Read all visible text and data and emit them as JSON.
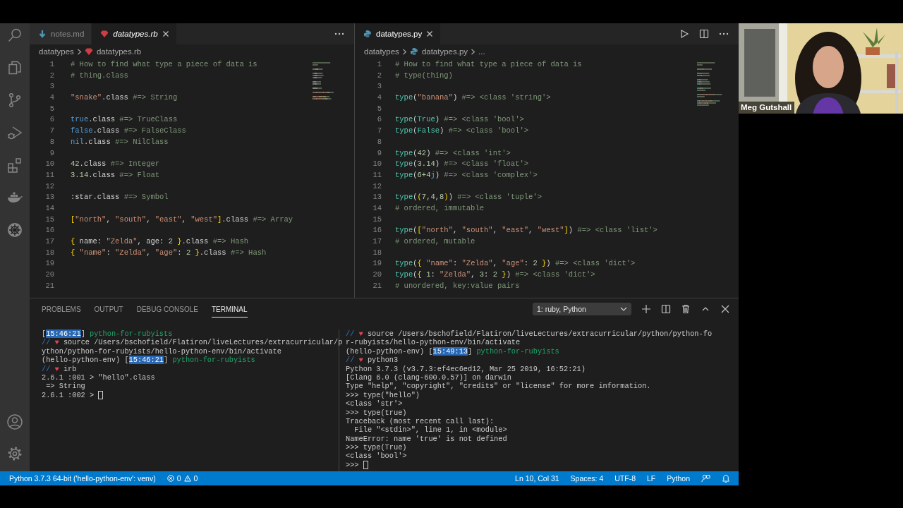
{
  "left_editor": {
    "tabs": [
      {
        "label": "notes.md",
        "kind": "markdown",
        "selected": false,
        "preview": false
      },
      {
        "label": "datatypes.rb",
        "kind": "ruby",
        "selected": true,
        "preview": true
      }
    ],
    "breadcrumb": [
      {
        "label": "datatypes"
      },
      {
        "label": "datatypes.rb",
        "kind": "ruby"
      }
    ],
    "lines": [
      {
        "number": "1",
        "tokens": [
          {
            "text": "# How to find what type a piece of data is",
            "kind": "comment"
          }
        ]
      },
      {
        "number": "2",
        "tokens": [
          {
            "text": "# thing.class",
            "kind": "comment"
          }
        ]
      },
      {
        "number": "3"
      },
      {
        "number": "4",
        "tokens": [
          {
            "text": "\"snake\"",
            "kind": "string"
          },
          {
            "text": ".class ",
            "kind": "plain"
          },
          {
            "text": "#=> String",
            "kind": "comment"
          }
        ]
      },
      {
        "number": "5"
      },
      {
        "number": "6",
        "tokens": [
          {
            "text": "true",
            "kind": "keyword"
          },
          {
            "text": ".class ",
            "kind": "plain"
          },
          {
            "text": "#=> TrueClass",
            "kind": "comment"
          }
        ]
      },
      {
        "number": "7",
        "tokens": [
          {
            "text": "false",
            "kind": "keyword"
          },
          {
            "text": ".class ",
            "kind": "plain"
          },
          {
            "text": "#=> FalseClass",
            "kind": "comment"
          }
        ]
      },
      {
        "number": "8",
        "tokens": [
          {
            "text": "nil",
            "kind": "keyword"
          },
          {
            "text": ".class ",
            "kind": "plain"
          },
          {
            "text": "#=> NilClass",
            "kind": "comment"
          }
        ]
      },
      {
        "number": "9"
      },
      {
        "number": "10",
        "tokens": [
          {
            "text": "42",
            "kind": "number"
          },
          {
            "text": ".class ",
            "kind": "plain"
          },
          {
            "text": "#=> Integer",
            "kind": "comment"
          }
        ]
      },
      {
        "number": "11",
        "tokens": [
          {
            "text": "3.14",
            "kind": "number"
          },
          {
            "text": ".class ",
            "kind": "plain"
          },
          {
            "text": "#=> Float",
            "kind": "comment"
          }
        ]
      },
      {
        "number": "12"
      },
      {
        "number": "13",
        "tokens": [
          {
            "text": ":star",
            "kind": "plain"
          },
          {
            "text": ".class ",
            "kind": "plain"
          },
          {
            "text": "#=> Symbol",
            "kind": "comment"
          }
        ]
      },
      {
        "number": "14"
      },
      {
        "number": "15",
        "tokens": [
          {
            "text": "[",
            "kind": "bracket"
          },
          {
            "text": "\"north\"",
            "kind": "string"
          },
          {
            "text": ", ",
            "kind": "plain"
          },
          {
            "text": "\"south\"",
            "kind": "string"
          },
          {
            "text": ", ",
            "kind": "plain"
          },
          {
            "text": "\"east\"",
            "kind": "string"
          },
          {
            "text": ", ",
            "kind": "plain"
          },
          {
            "text": "\"west\"",
            "kind": "string"
          },
          {
            "text": "]",
            "kind": "bracket"
          },
          {
            "text": ".class ",
            "kind": "plain"
          },
          {
            "text": "#=> Array",
            "kind": "comment"
          }
        ]
      },
      {
        "number": "16"
      },
      {
        "number": "17",
        "tokens": [
          {
            "text": "{",
            "kind": "bracket"
          },
          {
            "text": " name: ",
            "kind": "plain"
          },
          {
            "text": "\"Zelda\"",
            "kind": "string"
          },
          {
            "text": ", age: ",
            "kind": "plain"
          },
          {
            "text": "2",
            "kind": "number"
          },
          {
            "text": " }",
            "kind": "bracket"
          },
          {
            "text": ".class ",
            "kind": "plain"
          },
          {
            "text": "#=> Hash",
            "kind": "comment"
          }
        ]
      },
      {
        "number": "18",
        "tokens": [
          {
            "text": "{ ",
            "kind": "bracket"
          },
          {
            "text": "\"name\"",
            "kind": "string"
          },
          {
            "text": ": ",
            "kind": "plain"
          },
          {
            "text": "\"Zelda\"",
            "kind": "string"
          },
          {
            "text": ", ",
            "kind": "plain"
          },
          {
            "text": "\"age\"",
            "kind": "string"
          },
          {
            "text": ": ",
            "kind": "plain"
          },
          {
            "text": "2",
            "kind": "number"
          },
          {
            "text": " }",
            "kind": "bracket"
          },
          {
            "text": ".class ",
            "kind": "plain"
          },
          {
            "text": "#=> Hash",
            "kind": "comment"
          }
        ]
      },
      {
        "number": "19"
      },
      {
        "number": "20"
      },
      {
        "number": "21"
      }
    ]
  },
  "right_editor": {
    "tabs": [
      {
        "label": "datatypes.py",
        "kind": "python",
        "selected": true,
        "preview": false
      }
    ],
    "breadcrumb": [
      {
        "label": "datatypes"
      },
      {
        "label": "datatypes.py",
        "kind": "python"
      },
      {
        "label": "..."
      }
    ],
    "lines": [
      {
        "number": "1",
        "tokens": [
          {
            "text": "# How to find what type a piece of data is",
            "kind": "comment"
          }
        ]
      },
      {
        "number": "2",
        "tokens": [
          {
            "text": "# type(thing)",
            "kind": "comment"
          }
        ]
      },
      {
        "number": "3"
      },
      {
        "number": "4",
        "tokens": [
          {
            "text": "type",
            "kind": "function"
          },
          {
            "text": "(",
            "kind": "plain"
          },
          {
            "text": "\"banana\"",
            "kind": "string"
          },
          {
            "text": ") ",
            "kind": "plain"
          },
          {
            "text": "#=> <class 'string'>",
            "kind": "comment"
          }
        ]
      },
      {
        "number": "5"
      },
      {
        "number": "6",
        "tokens": [
          {
            "text": "type",
            "kind": "function"
          },
          {
            "text": "(",
            "kind": "plain"
          },
          {
            "text": "True",
            "kind": "constant"
          },
          {
            "text": ") ",
            "kind": "plain"
          },
          {
            "text": "#=> <class 'bool'>",
            "kind": "comment"
          }
        ]
      },
      {
        "number": "7",
        "tokens": [
          {
            "text": "type",
            "kind": "function"
          },
          {
            "text": "(",
            "kind": "plain"
          },
          {
            "text": "False",
            "kind": "constant"
          },
          {
            "text": ") ",
            "kind": "plain"
          },
          {
            "text": "#=> <class 'bool'>",
            "kind": "comment"
          }
        ]
      },
      {
        "number": "8"
      },
      {
        "number": "9",
        "tokens": [
          {
            "text": "type",
            "kind": "function"
          },
          {
            "text": "(",
            "kind": "plain"
          },
          {
            "text": "42",
            "kind": "number"
          },
          {
            "text": ") ",
            "kind": "plain"
          },
          {
            "text": "#=> <class 'int'>",
            "kind": "comment"
          }
        ]
      },
      {
        "number": "10",
        "tokens": [
          {
            "text": "type",
            "kind": "function"
          },
          {
            "text": "(",
            "kind": "plain"
          },
          {
            "text": "3.14",
            "kind": "number"
          },
          {
            "text": ") ",
            "kind": "plain"
          },
          {
            "text": "#=> <class 'float'>",
            "kind": "comment"
          }
        ]
      },
      {
        "number": "11",
        "tokens": [
          {
            "text": "type",
            "kind": "function"
          },
          {
            "text": "(",
            "kind": "plain"
          },
          {
            "text": "6+4",
            "kind": "number"
          },
          {
            "text": "j",
            "kind": "keyword"
          },
          {
            "text": ") ",
            "kind": "plain"
          },
          {
            "text": "#=> <class 'complex'>",
            "kind": "comment"
          }
        ]
      },
      {
        "number": "12"
      },
      {
        "number": "13",
        "tokens": [
          {
            "text": "type",
            "kind": "function"
          },
          {
            "text": "(",
            "kind": "plain"
          },
          {
            "text": "(",
            "kind": "bracket"
          },
          {
            "text": "7,4,8",
            "kind": "number"
          },
          {
            "text": ")",
            "kind": "bracket"
          },
          {
            "text": ") ",
            "kind": "plain"
          },
          {
            "text": "#=> <class 'tuple'>",
            "kind": "comment"
          }
        ]
      },
      {
        "number": "14",
        "tokens": [
          {
            "text": "# ordered, immutable",
            "kind": "comment"
          }
        ]
      },
      {
        "number": "15"
      },
      {
        "number": "16",
        "tokens": [
          {
            "text": "type",
            "kind": "function"
          },
          {
            "text": "(",
            "kind": "plain"
          },
          {
            "text": "[",
            "kind": "bracket"
          },
          {
            "text": "\"north\"",
            "kind": "string"
          },
          {
            "text": ", ",
            "kind": "plain"
          },
          {
            "text": "\"south\"",
            "kind": "string"
          },
          {
            "text": ", ",
            "kind": "plain"
          },
          {
            "text": "\"east\"",
            "kind": "string"
          },
          {
            "text": ", ",
            "kind": "plain"
          },
          {
            "text": "\"west\"",
            "kind": "string"
          },
          {
            "text": "]",
            "kind": "bracket"
          },
          {
            "text": ") ",
            "kind": "plain"
          },
          {
            "text": "#=> <class 'list'>",
            "kind": "comment"
          }
        ]
      },
      {
        "number": "17",
        "tokens": [
          {
            "text": "# ordered, mutable",
            "kind": "comment"
          }
        ]
      },
      {
        "number": "18"
      },
      {
        "number": "19",
        "tokens": [
          {
            "text": "type",
            "kind": "function"
          },
          {
            "text": "(",
            "kind": "plain"
          },
          {
            "text": "{ ",
            "kind": "bracket"
          },
          {
            "text": "\"name\"",
            "kind": "string"
          },
          {
            "text": ": ",
            "kind": "plain"
          },
          {
            "text": "\"Zelda\"",
            "kind": "string"
          },
          {
            "text": ", ",
            "kind": "plain"
          },
          {
            "text": "\"age\"",
            "kind": "string"
          },
          {
            "text": ": ",
            "kind": "plain"
          },
          {
            "text": "2",
            "kind": "number"
          },
          {
            "text": " }",
            "kind": "bracket"
          },
          {
            "text": ") ",
            "kind": "plain"
          },
          {
            "text": "#=> <class 'dict'>",
            "kind": "comment"
          }
        ]
      },
      {
        "number": "20",
        "tokens": [
          {
            "text": "type",
            "kind": "function"
          },
          {
            "text": "(",
            "kind": "plain"
          },
          {
            "text": "{ ",
            "kind": "bracket"
          },
          {
            "text": "1",
            "kind": "number"
          },
          {
            "text": ": ",
            "kind": "plain"
          },
          {
            "text": "\"Zelda\"",
            "kind": "string"
          },
          {
            "text": ", ",
            "kind": "plain"
          },
          {
            "text": "3",
            "kind": "number"
          },
          {
            "text": ": ",
            "kind": "plain"
          },
          {
            "text": "2",
            "kind": "number"
          },
          {
            "text": " }",
            "kind": "bracket"
          },
          {
            "text": ") ",
            "kind": "plain"
          },
          {
            "text": "#=> <class 'dict'>",
            "kind": "comment"
          }
        ]
      },
      {
        "number": "21",
        "tokens": [
          {
            "text": "# unordered, key:value pairs",
            "kind": "comment"
          }
        ]
      }
    ]
  },
  "panel": {
    "tabs": [
      {
        "label": "PROBLEMS",
        "selected": false
      },
      {
        "label": "OUTPUT",
        "selected": false
      },
      {
        "label": "DEBUG CONSOLE",
        "selected": false
      },
      {
        "label": "TERMINAL",
        "selected": true
      }
    ],
    "terminal_selector": "1: ruby, Python",
    "terminals": [
      {
        "cursor": true,
        "lines": [
          [
            {
              "text": "[",
              "kind": "plain"
            },
            {
              "text": "15:46:21",
              "kind": "time"
            },
            {
              "text": "] ",
              "kind": "plain"
            },
            {
              "text": "python-for-rubyists",
              "kind": "folder"
            }
          ],
          [
            {
              "text": "// ",
              "kind": "prompt"
            },
            {
              "text": "♥",
              "kind": "heart"
            },
            {
              "text": " source /Users/bschofield/Flatiron/liveLectures/extracurricular/p",
              "kind": "plain"
            }
          ],
          [
            {
              "text": "ython/python-for-rubyists/hello-python-env/bin/activate",
              "kind": "plain"
            }
          ],
          [
            {
              "text": "(hello-python-env) [",
              "kind": "plain"
            },
            {
              "text": "15:46:21",
              "kind": "time"
            },
            {
              "text": "] ",
              "kind": "plain"
            },
            {
              "text": "python-for-rubyists",
              "kind": "folder"
            }
          ],
          [
            {
              "text": "// ",
              "kind": "prompt"
            },
            {
              "text": "♥",
              "kind": "heart"
            },
            {
              "text": " irb",
              "kind": "plain"
            }
          ],
          [
            {
              "text": "2.6.1 :001 > \"hello\".class",
              "kind": "plain"
            }
          ],
          [
            {
              "text": " => String",
              "kind": "plain"
            }
          ],
          [
            {
              "text": "2.6.1 :002 > ",
              "kind": "plain"
            }
          ]
        ]
      },
      {
        "cursor": true,
        "lines": [
          [
            {
              "text": "// ",
              "kind": "prompt"
            },
            {
              "text": "♥",
              "kind": "heart"
            },
            {
              "text": " source /Users/bschofield/Flatiron/liveLectures/extracurricular/python/python-fo",
              "kind": "plain"
            }
          ],
          [
            {
              "text": "r-rubyists/hello-python-env/bin/activate",
              "kind": "plain"
            }
          ],
          [
            {
              "text": "(hello-python-env) [",
              "kind": "plain"
            },
            {
              "text": "15:49:13",
              "kind": "time"
            },
            {
              "text": "] ",
              "kind": "plain"
            },
            {
              "text": "python-for-rubyists",
              "kind": "folder"
            }
          ],
          [
            {
              "text": "// ",
              "kind": "prompt"
            },
            {
              "text": "♥",
              "kind": "heart"
            },
            {
              "text": " python3",
              "kind": "plain"
            }
          ],
          [
            {
              "text": "Python 3.7.3 (v3.7.3:ef4ec6ed12, Mar 25 2019, 16:52:21)",
              "kind": "plain"
            }
          ],
          [
            {
              "text": "[Clang 6.0 (clang-600.0.57)] on darwin",
              "kind": "plain"
            }
          ],
          [
            {
              "text": "Type \"help\", \"copyright\", \"credits\" or \"license\" for more information.",
              "kind": "plain"
            }
          ],
          [
            {
              "text": ">>> type(\"hello\")",
              "kind": "plain"
            }
          ],
          [
            {
              "text": "<class 'str'>",
              "kind": "plain"
            }
          ],
          [
            {
              "text": ">>> type(true)",
              "kind": "plain"
            }
          ],
          [
            {
              "text": "Traceback (most recent call last):",
              "kind": "plain"
            }
          ],
          [
            {
              "text": "  File \"<stdin>\", line 1, in <module>",
              "kind": "plain"
            }
          ],
          [
            {
              "text": "NameError: name 'true' is not defined",
              "kind": "plain"
            }
          ],
          [
            {
              "text": ">>> type(True)",
              "kind": "plain"
            }
          ],
          [
            {
              "text": "<class 'bool'>",
              "kind": "plain"
            }
          ],
          [
            {
              "text": ">>> ",
              "kind": "plain"
            }
          ]
        ]
      }
    ]
  },
  "status_bar": {
    "interpreter": "Python 3.7.3 64-bit ('hello-python-env': venv)",
    "errors": "0",
    "warnings": "0",
    "items": [
      "Ln 10, Col 31",
      "Spaces: 4",
      "UTF-8",
      "LF",
      "Python"
    ]
  },
  "video": {
    "name": "Meg Gutshall"
  }
}
